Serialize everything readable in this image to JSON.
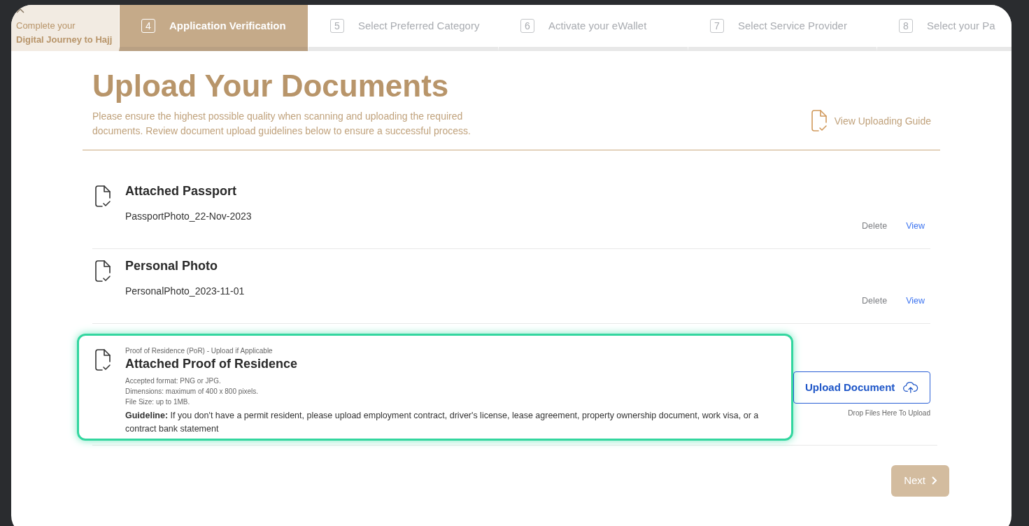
{
  "journey": {
    "line_1": "Complete your",
    "line_2": "Digital Journey to Hajj"
  },
  "steps": [
    {
      "number": "4",
      "label": "Application Verification",
      "selected": true
    },
    {
      "number": "5",
      "label": "Select Preferred Category",
      "selected": false
    },
    {
      "number": "6",
      "label": "Activate your eWallet",
      "selected": false
    },
    {
      "number": "7",
      "label": "Select Service Provider",
      "selected": false
    },
    {
      "number": "8",
      "label": "Select your Pa",
      "selected": false
    }
  ],
  "title": "Upload Your Documents",
  "intro": "Please ensure the highest possible quality when scanning and uploading the required documents. Review document upload guidelines below to ensure a successful process.",
  "guide_link": "View Uploading Guide",
  "documents": [
    {
      "kind": "attached",
      "title": "Attached Passport",
      "file": "PassportPhoto_22-Nov-2023",
      "actions": [
        "Delete",
        "View"
      ],
      "highlighted": false
    },
    {
      "kind": "attached",
      "title": "Personal Photo",
      "file": "PersonalPhoto_2023-11-01",
      "actions": [
        "Delete",
        "View"
      ],
      "highlighted": false
    },
    {
      "kind": "upload",
      "caption": "Proof of Residence (PoR) - Upload if Applicable",
      "title": "Attached Proof of Residence",
      "requirements": [
        "Accepted format: PNG or JPG.",
        "Dimensions: maximum of 400 x 800 pixels.",
        "File Size: up to 1MB."
      ],
      "guideline": "**Guideline:** If you don't have a permit resident, please upload employment contract, driver's license, lease agreement, property ownership document, work visa, or a contract bank statement",
      "button": "Upload Document",
      "drop_hint": "Drop Files Here To Upload",
      "highlighted": true
    }
  ],
  "next_button": {
    "label": "Next",
    "disabled": true
  }
}
